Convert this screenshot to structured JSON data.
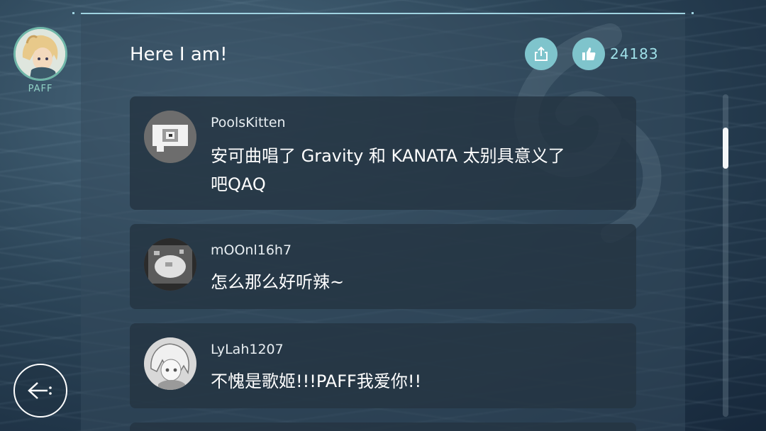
{
  "character": {
    "name": "PAFF",
    "avatar_icon": "paff-portrait-icon"
  },
  "song": {
    "title": "Here I am!"
  },
  "actions": {
    "share_icon": "share-icon",
    "like_icon": "thumbs-up-icon",
    "like_count": "24183"
  },
  "comments": [
    {
      "user": "PoolsKitten",
      "text_line1": "安可曲唱了 Gravity 和 KANATA 太别具意义了",
      "text_line2": "吧QAQ",
      "avatar_icon": "pixel-speech-bubble-avatar"
    },
    {
      "user": "mOOnl16h7",
      "text_line1": "怎么那么好听辣~",
      "text_line2": "",
      "avatar_icon": "pixel-orb-avatar"
    },
    {
      "user": "LyLah1207",
      "text_line1": "不愧是歌姬!!!PAFF我爱你!!",
      "text_line2": "",
      "avatar_icon": "anime-girl-avatar"
    }
  ],
  "navigation": {
    "back_icon": "back-arrow-icon"
  },
  "colors": {
    "accent": "#7fc4cc",
    "like_count": "#9fe0e8",
    "character_ring": "#6fb6a8",
    "character_name": "#8fd0c4"
  }
}
